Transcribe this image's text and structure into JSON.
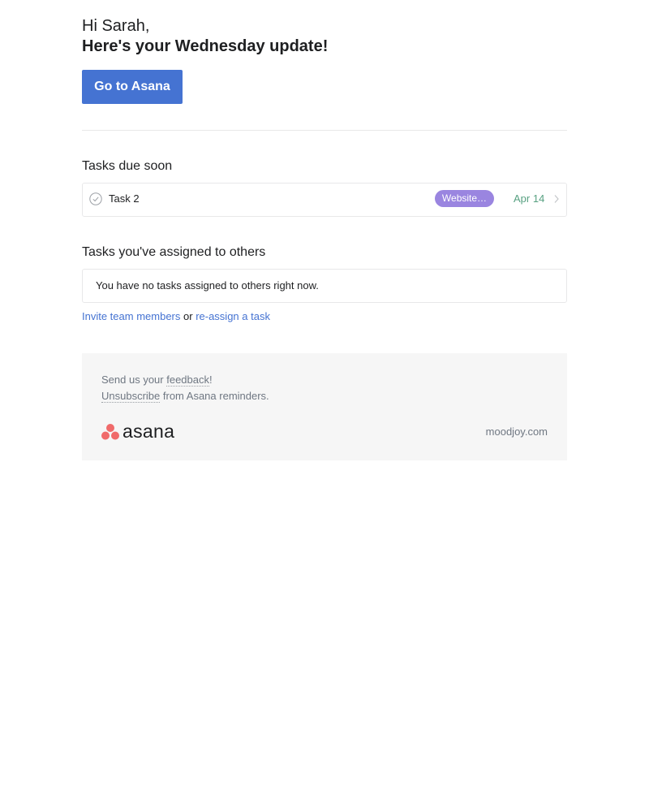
{
  "header": {
    "greeting": "Hi Sarah,",
    "headline": "Here's your Wednesday update!",
    "cta_label": "Go to Asana"
  },
  "due_soon": {
    "title": "Tasks due soon",
    "tasks": [
      {
        "name": "Task 2",
        "project": "Website…",
        "due": "Apr 14"
      }
    ]
  },
  "assigned_to_others": {
    "title": "Tasks you've assigned to others",
    "empty_message": "You have no tasks assigned to others right now.",
    "invite_link": "Invite team members",
    "connector": "or",
    "reassign_link": "re-assign a task"
  },
  "footer": {
    "feedback_prefix": "Send us your",
    "feedback_link": "feedback",
    "feedback_suffix": "!",
    "unsubscribe_link": "Unsubscribe",
    "unsubscribe_suffix": "from Asana reminders.",
    "logo_text": "asana",
    "domain": "moodjoy.com"
  },
  "colors": {
    "accent": "#4573d2",
    "project_pill": "#9a85e0",
    "due_date": "#58a182",
    "logo_coral": "#f06a6a",
    "footer_bg": "#f6f6f6"
  },
  "icons": {
    "task_check": "check-circle-icon",
    "row_chevron": "chevron-right-icon",
    "logo_mark": "asana-dots-icon"
  }
}
